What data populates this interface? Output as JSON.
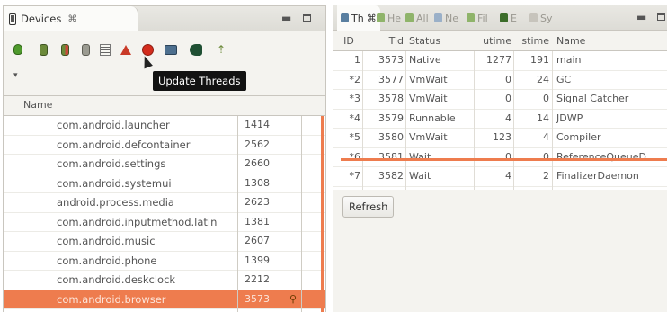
{
  "devices_view": {
    "tab_title": "Devices",
    "tab_close_glyph": "⌘",
    "minimize_glyph": "▬",
    "tooltip": "Update Threads",
    "toolbar_icons": [
      "debug-icon",
      "update-heap-icon",
      "dump-hprof-icon",
      "cause-gc-icon",
      "update-threads-icon",
      "start-method-profiling-icon",
      "stop-process-icon",
      "screen-capture-icon",
      "dump-view-hierarchy-icon",
      "systrace-icon"
    ],
    "column_header": "Name",
    "rows": [
      {
        "name": "com.android.launcher",
        "pid": "1414"
      },
      {
        "name": "com.android.defcontainer",
        "pid": "2562"
      },
      {
        "name": "com.android.settings",
        "pid": "2660"
      },
      {
        "name": "com.android.systemui",
        "pid": "1308"
      },
      {
        "name": "android.process.media",
        "pid": "2623"
      },
      {
        "name": "com.android.inputmethod.latin",
        "pid": "1381"
      },
      {
        "name": "com.android.music",
        "pid": "2607"
      },
      {
        "name": "com.android.phone",
        "pid": "1399"
      },
      {
        "name": "com.android.deskclock",
        "pid": "2212"
      },
      {
        "name": "com.android.browser",
        "pid": "3573",
        "selected": true
      }
    ],
    "selected_debug_glyph": "⚲"
  },
  "threads_view": {
    "tabs": [
      {
        "label": "Th",
        "glyph": "⌘",
        "active": true
      },
      {
        "label": "He"
      },
      {
        "label": "All"
      },
      {
        "label": "Ne"
      },
      {
        "label": "Fil"
      },
      {
        "label": "E"
      },
      {
        "label": "Sy"
      }
    ],
    "minimize_glyph": "▬",
    "columns": [
      "ID",
      "Tid",
      "Status",
      "utime",
      "stime",
      "Name"
    ],
    "rows": [
      {
        "id": "1",
        "tid": "3573",
        "status": "Native",
        "utime": "1277",
        "stime": "191",
        "name": "main"
      },
      {
        "id": "*2",
        "tid": "3577",
        "status": "VmWait",
        "utime": "0",
        "stime": "24",
        "name": "GC"
      },
      {
        "id": "*3",
        "tid": "3578",
        "status": "VmWait",
        "utime": "0",
        "stime": "0",
        "name": "Signal Catcher"
      },
      {
        "id": "*4",
        "tid": "3579",
        "status": "Runnable",
        "utime": "4",
        "stime": "14",
        "name": "JDWP"
      },
      {
        "id": "*5",
        "tid": "3580",
        "status": "VmWait",
        "utime": "123",
        "stime": "4",
        "name": "Compiler"
      },
      {
        "id": "*6",
        "tid": "3581",
        "status": "Wait",
        "utime": "0",
        "stime": "0",
        "name": "ReferenceQueueD"
      },
      {
        "id": "*7",
        "tid": "3582",
        "status": "Wait",
        "utime": "4",
        "stime": "2",
        "name": "FinalizerDaemon"
      }
    ],
    "refresh_label": "Refresh"
  }
}
